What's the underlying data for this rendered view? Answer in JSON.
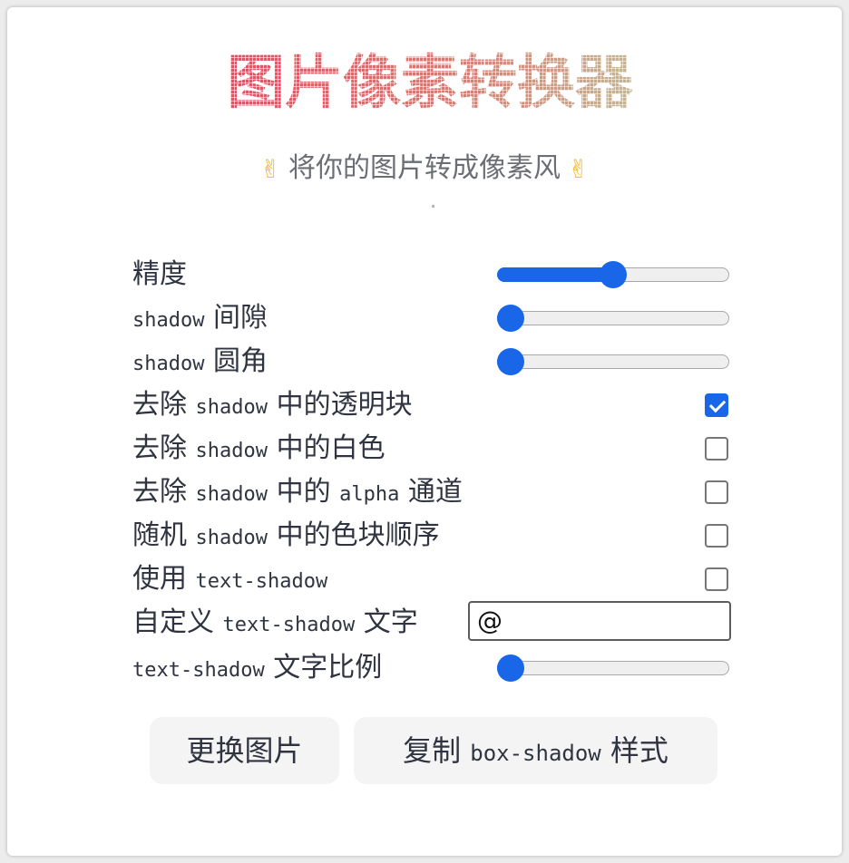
{
  "header": {
    "title": "图片像素转换器",
    "subtitle_emoji": "✌",
    "subtitle": "将你的图片转成像素风"
  },
  "controls": {
    "precision": {
      "label": "精度",
      "value": 0.5
    },
    "shadow_gap": {
      "label_mono": "shadow",
      "label_rest": "间隙",
      "value": 0.0
    },
    "shadow_radius": {
      "label_mono": "shadow",
      "label_rest": "圆角",
      "value": 0.0
    },
    "remove_transparent": {
      "label_a": "去除",
      "label_mono": "shadow",
      "label_b": "中的透明块",
      "checked": true
    },
    "remove_white": {
      "label_a": "去除",
      "label_mono": "shadow",
      "label_b": "中的白色",
      "checked": false
    },
    "remove_alpha": {
      "label_a": "去除",
      "label_mono": "shadow",
      "label_b": "中的",
      "label_mono2": "alpha",
      "label_c": "通道",
      "checked": false
    },
    "random_order": {
      "label_a": "随机",
      "label_mono": "shadow",
      "label_b": "中的色块顺序",
      "checked": false
    },
    "use_text_shadow": {
      "label_a": "使用",
      "label_mono": "text-shadow",
      "checked": false
    },
    "custom_text": {
      "label_a": "自定义",
      "label_mono": "text-shadow",
      "label_b": "文字",
      "value": "@"
    },
    "text_scale": {
      "label_mono": "text-shadow",
      "label_rest": "文字比例",
      "value": 0.0
    }
  },
  "buttons": {
    "change_image": "更换图片",
    "copy_a": "复制",
    "copy_mono": "box-shadow",
    "copy_b": "样式"
  },
  "colors": {
    "accent": "#1967e8",
    "title_gradient": [
      "#ef4b5f",
      "#c6b68e"
    ]
  }
}
